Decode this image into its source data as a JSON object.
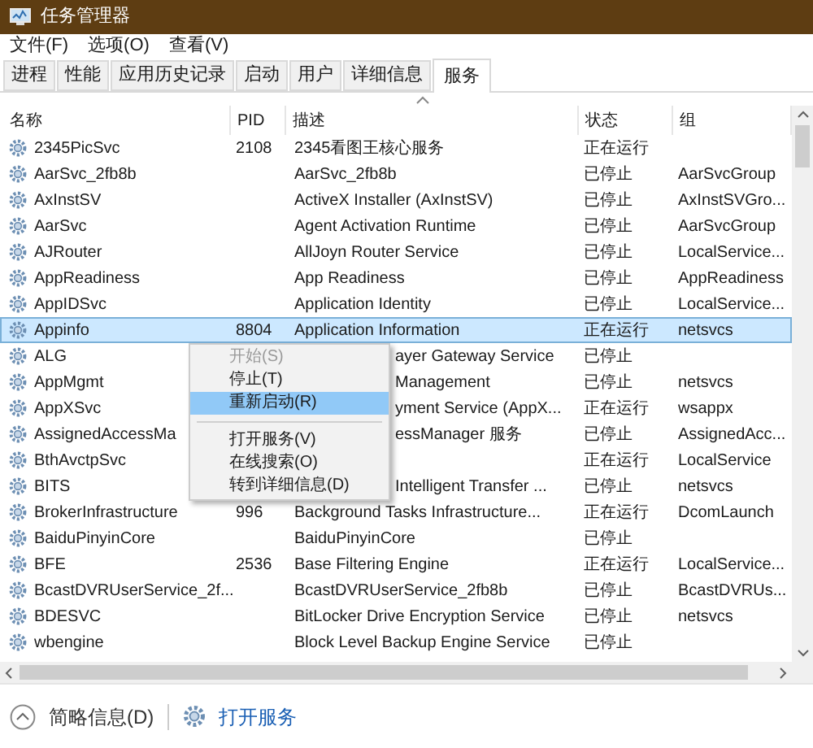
{
  "window": {
    "title": "任务管理器"
  },
  "menu_bar": [
    "文件(F)",
    "选项(O)",
    "查看(V)"
  ],
  "tabs": [
    {
      "label": "进程",
      "selected": false
    },
    {
      "label": "性能",
      "selected": false
    },
    {
      "label": "应用历史记录",
      "selected": false
    },
    {
      "label": "启动",
      "selected": false
    },
    {
      "label": "用户",
      "selected": false
    },
    {
      "label": "详细信息",
      "selected": false
    },
    {
      "label": "服务",
      "selected": true
    }
  ],
  "table": {
    "columns": [
      "名称",
      "PID",
      "描述",
      "状态",
      "组"
    ],
    "rows": [
      {
        "name": "2345PicSvc",
        "pid": "2108",
        "description": "2345看图王核心服务",
        "status": "正在运行",
        "group": "",
        "selected": false,
        "kind": "full"
      },
      {
        "name": "AarSvc_2fb8b",
        "pid": "",
        "description": "AarSvc_2fb8b",
        "status": "已停止",
        "group": "AarSvcGroup",
        "selected": false,
        "kind": "full"
      },
      {
        "name": "AxInstSV",
        "pid": "",
        "description": "ActiveX Installer (AxInstSV)",
        "status": "已停止",
        "group": "AxInstSVGro...",
        "selected": false,
        "kind": "full"
      },
      {
        "name": "AarSvc",
        "pid": "",
        "description": "Agent Activation Runtime",
        "status": "已停止",
        "group": "AarSvcGroup",
        "selected": false,
        "kind": "full"
      },
      {
        "name": "AJRouter",
        "pid": "",
        "description": "AllJoyn Router Service",
        "status": "已停止",
        "group": "LocalService...",
        "selected": false,
        "kind": "full"
      },
      {
        "name": "AppReadiness",
        "pid": "",
        "description": "App Readiness",
        "status": "已停止",
        "group": "AppReadiness",
        "selected": false,
        "kind": "full"
      },
      {
        "name": "AppIDSvc",
        "pid": "",
        "description": "Application Identity",
        "status": "已停止",
        "group": "LocalService...",
        "selected": false,
        "kind": "full"
      },
      {
        "name": "Appinfo",
        "pid": "8804",
        "description": "Application Information",
        "status": "正在运行",
        "group": "netsvcs",
        "selected": true,
        "kind": "full"
      },
      {
        "name": "ALG",
        "pid": "",
        "description": "ayer Gateway Service",
        "status": "已停止",
        "group": "",
        "selected": false,
        "kind": "covered"
      },
      {
        "name": "AppMgmt",
        "pid": "",
        "description": "Management",
        "status": "已停止",
        "group": "netsvcs",
        "selected": false,
        "kind": "covered"
      },
      {
        "name": "AppXSvc",
        "pid": "",
        "description": "yment Service (AppX...",
        "status": "正在运行",
        "group": "wsappx",
        "selected": false,
        "kind": "covered"
      },
      {
        "name": "AssignedAccessMa",
        "pid": "",
        "description": "essManager 服务",
        "status": "已停止",
        "group": "AssignedAcc...",
        "selected": false,
        "kind": "covered"
      },
      {
        "name": "BthAvctpSvc",
        "pid": "",
        "description": "",
        "status": "正在运行",
        "group": "LocalService",
        "selected": false,
        "kind": "covered"
      },
      {
        "name": "BITS",
        "pid": "",
        "description": "Intelligent Transfer ...",
        "status": "已停止",
        "group": "netsvcs",
        "selected": false,
        "kind": "covered"
      },
      {
        "name": "BrokerInfrastructure",
        "pid": "996",
        "description": "Background Tasks Infrastructure...",
        "status": "正在运行",
        "group": "DcomLaunch",
        "selected": false,
        "kind": "full"
      },
      {
        "name": "BaiduPinyinCore",
        "pid": "",
        "description": "BaiduPinyinCore",
        "status": "已停止",
        "group": "",
        "selected": false,
        "kind": "full"
      },
      {
        "name": "BFE",
        "pid": "2536",
        "description": "Base Filtering Engine",
        "status": "正在运行",
        "group": "LocalService...",
        "selected": false,
        "kind": "full"
      },
      {
        "name": "BcastDVRUserService_2f...",
        "pid": "",
        "description": "BcastDVRUserService_2fb8b",
        "status": "已停止",
        "group": "BcastDVRUs...",
        "selected": false,
        "kind": "full"
      },
      {
        "name": "BDESVC",
        "pid": "",
        "description": "BitLocker Drive Encryption Service",
        "status": "已停止",
        "group": "netsvcs",
        "selected": false,
        "kind": "full"
      },
      {
        "name": "wbengine",
        "pid": "",
        "description": "Block Level Backup Engine Service",
        "status": "已停止",
        "group": "",
        "selected": false,
        "kind": "full"
      }
    ]
  },
  "context_menu": [
    {
      "label": "开始(S)",
      "disabled": true,
      "selected": false,
      "kind": "item"
    },
    {
      "label": "停止(T)",
      "disabled": false,
      "selected": false,
      "kind": "item"
    },
    {
      "label": "重新启动(R)",
      "disabled": false,
      "selected": true,
      "kind": "item"
    },
    {
      "kind": "separator"
    },
    {
      "label": "打开服务(V)",
      "disabled": false,
      "selected": false,
      "kind": "item"
    },
    {
      "label": "在线搜索(O)",
      "disabled": false,
      "selected": false,
      "kind": "item"
    },
    {
      "label": "转到详细信息(D)",
      "disabled": false,
      "selected": false,
      "kind": "item"
    }
  ],
  "footer": {
    "less_details": "简略信息(D)",
    "open_services": "打开服务"
  }
}
